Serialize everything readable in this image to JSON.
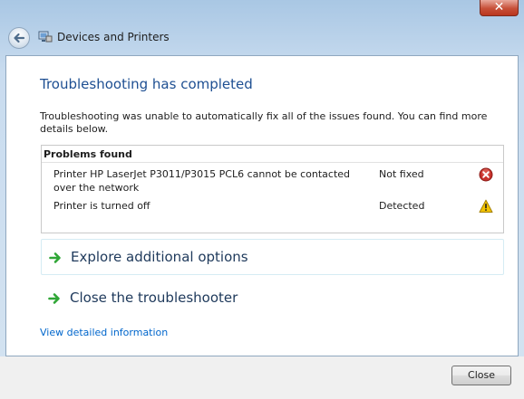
{
  "window": {
    "close_glyph": "✕"
  },
  "navbar": {
    "title": "Devices and Printers",
    "icon": "devices-printers-icon"
  },
  "page": {
    "title": "Troubleshooting has completed",
    "description": "Troubleshooting was unable to automatically fix all of the issues found. You can find more details below."
  },
  "problems": {
    "header": "Problems found",
    "items": [
      {
        "description": "Printer HP LaserJet P3011/P3015 PCL6 cannot be contacted over the network",
        "status": "Not fixed",
        "icon": "error-icon"
      },
      {
        "description": "Printer is turned off",
        "status": "Detected",
        "icon": "warning-icon"
      }
    ]
  },
  "options": {
    "explore": "Explore additional options",
    "close": "Close the troubleshooter"
  },
  "links": {
    "details": "View detailed information"
  },
  "footer": {
    "close_button": "Close"
  },
  "colors": {
    "title": "#1e4f92",
    "link": "#0066cc",
    "arrow": "#2fa636",
    "error": "#c8312b",
    "warning": "#f2c300"
  }
}
